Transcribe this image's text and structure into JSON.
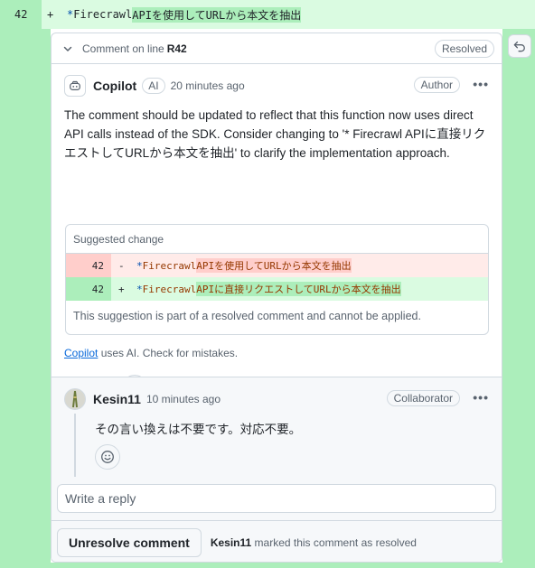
{
  "diff_line": {
    "number": "42",
    "sign": "+",
    "comment_marker": "* ",
    "code_prefix": "Firecrawl ",
    "code_highlight": "APIを使用してURLから本文を抽出"
  },
  "header": {
    "label": "Comment on line",
    "line_ref": "R42",
    "resolved_badge": "Resolved"
  },
  "comment1": {
    "author": "Copilot",
    "ai_label": "AI",
    "time": "20 minutes ago",
    "badge": "Author",
    "body": "The comment should be updated to reflect that this function now uses direct API calls instead of the SDK. Consider changing to '* Firecrawl APIに直接リクエストしてURLから本文を抽出' to clarify the implementation approach.",
    "suggestion": {
      "title": "Suggested change",
      "old_line": {
        "number": "42",
        "sign": "-",
        "marker": "* ",
        "prefix": "Firecrawl ",
        "text": "APIを使用してURLから本文を抽出"
      },
      "new_line": {
        "number": "42",
        "sign": "+",
        "marker": "* ",
        "prefix": "Firecrawl ",
        "text": "APIに直接リクエストしてURLから本文を抽出"
      },
      "note": "This suggestion is part of a resolved comment and cannot be applied."
    },
    "disclaimer_link": "Copilot",
    "disclaimer_text": " uses AI. Check for mistakes."
  },
  "comment2": {
    "author": "Kesin11",
    "time": "10 minutes ago",
    "badge": "Collaborator",
    "body": "その言い換えは不要です。対応不要。"
  },
  "reply": {
    "placeholder": "Write a reply"
  },
  "footer": {
    "unresolve_label": "Unresolve comment",
    "resolver": "Kesin11",
    "resolved_text": " marked this comment as resolved"
  },
  "icons": {
    "chevron": "chevron-down-icon",
    "undo": "undo-icon",
    "copilot": "copilot-icon",
    "kebab": "kebab-horizontal-icon",
    "thumbs_up": "thumbs-up-icon",
    "thumbs_down": "thumbs-down-icon",
    "smiley": "smiley-icon"
  },
  "colors": {
    "add_bg": "#dafbe1",
    "add_gutter": "#aceebb",
    "del_bg": "#ffebe9",
    "del_gutter": "#ffcecb",
    "link": "#0969da"
  }
}
